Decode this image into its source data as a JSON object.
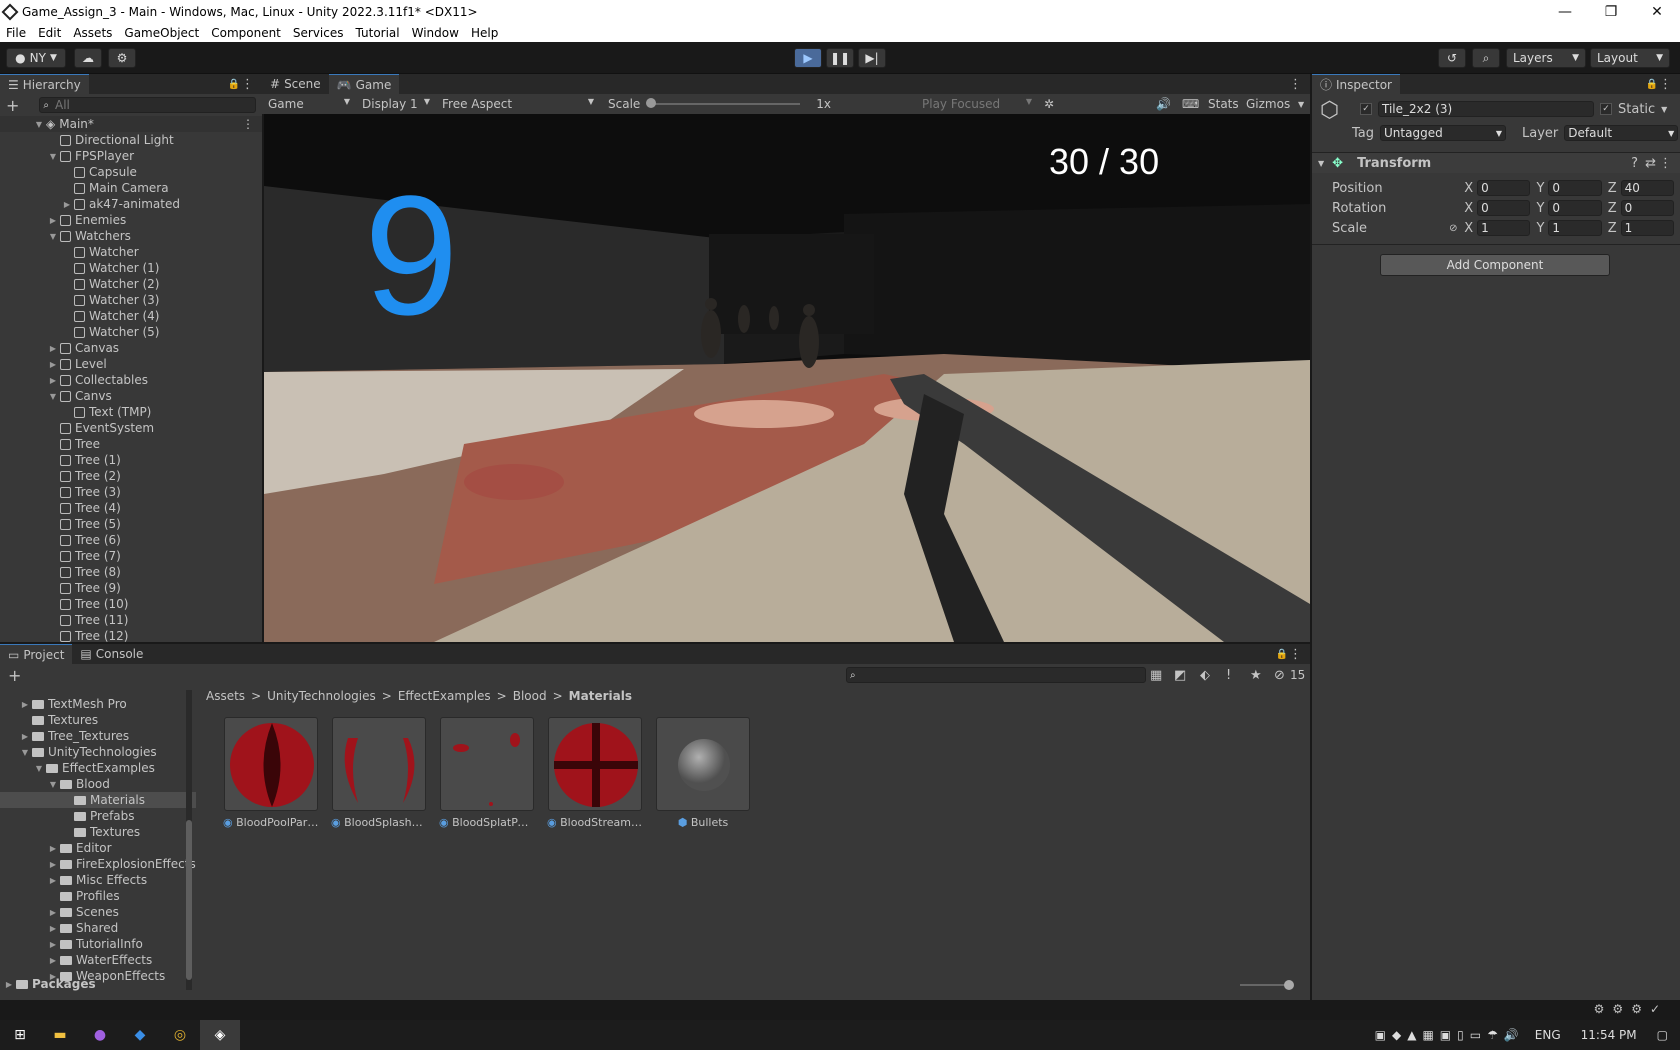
{
  "window": {
    "title": "Game_Assign_3 - Main - Windows, Mac, Linux - Unity 2022.3.11f1* <DX11>",
    "minimize": "—",
    "maximize": "❐",
    "close": "✕"
  },
  "menu": [
    "File",
    "Edit",
    "Assets",
    "GameObject",
    "Component",
    "Services",
    "Tutorial",
    "Window",
    "Help"
  ],
  "toolbar": {
    "account": "NY",
    "layers": "Layers",
    "layout": "Layout"
  },
  "hierarchy": {
    "tab": "Hierarchy",
    "search_placeholder": "All",
    "scene": "Main*",
    "items": [
      {
        "label": "Directional Light",
        "depth": 1,
        "arrow": ""
      },
      {
        "label": "FPSPlayer",
        "depth": 1,
        "arrow": "▼"
      },
      {
        "label": "Capsule",
        "depth": 2,
        "arrow": ""
      },
      {
        "label": "Main Camera",
        "depth": 2,
        "arrow": ""
      },
      {
        "label": "ak47-animated",
        "depth": 2,
        "arrow": "▶"
      },
      {
        "label": "Enemies",
        "depth": 1,
        "arrow": "▶"
      },
      {
        "label": "Watchers",
        "depth": 1,
        "arrow": "▼"
      },
      {
        "label": "Watcher",
        "depth": 2,
        "arrow": ""
      },
      {
        "label": "Watcher (1)",
        "depth": 2,
        "arrow": ""
      },
      {
        "label": "Watcher (2)",
        "depth": 2,
        "arrow": ""
      },
      {
        "label": "Watcher (3)",
        "depth": 2,
        "arrow": ""
      },
      {
        "label": "Watcher (4)",
        "depth": 2,
        "arrow": ""
      },
      {
        "label": "Watcher (5)",
        "depth": 2,
        "arrow": ""
      },
      {
        "label": "Canvas",
        "depth": 1,
        "arrow": "▶"
      },
      {
        "label": "Level",
        "depth": 1,
        "arrow": "▶"
      },
      {
        "label": "Collectables",
        "depth": 1,
        "arrow": "▶"
      },
      {
        "label": "Canvs",
        "depth": 1,
        "arrow": "▼"
      },
      {
        "label": "Text (TMP)",
        "depth": 2,
        "arrow": ""
      },
      {
        "label": "EventSystem",
        "depth": 1,
        "arrow": ""
      },
      {
        "label": "Tree",
        "depth": 1,
        "arrow": ""
      },
      {
        "label": "Tree (1)",
        "depth": 1,
        "arrow": ""
      },
      {
        "label": "Tree (2)",
        "depth": 1,
        "arrow": ""
      },
      {
        "label": "Tree (3)",
        "depth": 1,
        "arrow": ""
      },
      {
        "label": "Tree (4)",
        "depth": 1,
        "arrow": ""
      },
      {
        "label": "Tree (5)",
        "depth": 1,
        "arrow": ""
      },
      {
        "label": "Tree (6)",
        "depth": 1,
        "arrow": ""
      },
      {
        "label": "Tree (7)",
        "depth": 1,
        "arrow": ""
      },
      {
        "label": "Tree (8)",
        "depth": 1,
        "arrow": ""
      },
      {
        "label": "Tree (9)",
        "depth": 1,
        "arrow": ""
      },
      {
        "label": "Tree (10)",
        "depth": 1,
        "arrow": ""
      },
      {
        "label": "Tree (11)",
        "depth": 1,
        "arrow": ""
      },
      {
        "label": "Tree (12)",
        "depth": 1,
        "arrow": ""
      }
    ]
  },
  "game_view": {
    "tabs": [
      "Scene",
      "Game"
    ],
    "mode": "Game",
    "display": "Display 1",
    "aspect": "Free Aspect",
    "scale_label": "Scale",
    "scale_value": "1x",
    "play_focused": "Play Focused",
    "stats": "Stats",
    "gizmos": "Gizmos",
    "hud_count": "9",
    "hud_ammo": "30 / 30",
    "hud_color": "#1f8ef0"
  },
  "inspector": {
    "tab": "Inspector",
    "object_name": "Tile_2x2 (3)",
    "static_label": "Static",
    "tag_label": "Tag",
    "tag_value": "Untagged",
    "layer_label": "Layer",
    "layer_value": "Default",
    "component": "Transform",
    "position_label": "Position",
    "rotation_label": "Rotation",
    "scale_label": "Scale",
    "position": {
      "x": "0",
      "y": "0",
      "z": "40"
    },
    "rotation": {
      "x": "0",
      "y": "0",
      "z": "0"
    },
    "scale": {
      "x": "1",
      "y": "1",
      "z": "1"
    },
    "axis": {
      "x": "X",
      "y": "Y",
      "z": "Z"
    },
    "add_component": "Add Component"
  },
  "project": {
    "tabs": [
      "Project",
      "Console"
    ],
    "hidden_count": "15",
    "breadcrumb": [
      "Assets",
      "UnityTechnologies",
      "EffectExamples",
      "Blood",
      "Materials"
    ],
    "tree": [
      {
        "label": "TextMesh Pro",
        "depth": 1,
        "arrow": "▶"
      },
      {
        "label": "Textures",
        "depth": 1,
        "arrow": ""
      },
      {
        "label": "Tree_Textures",
        "depth": 1,
        "arrow": "▶"
      },
      {
        "label": "UnityTechnologies",
        "depth": 1,
        "arrow": "▼"
      },
      {
        "label": "EffectExamples",
        "depth": 2,
        "arrow": "▼"
      },
      {
        "label": "Blood",
        "depth": 3,
        "arrow": "▼"
      },
      {
        "label": "Materials",
        "depth": 4,
        "arrow": "",
        "selected": true
      },
      {
        "label": "Prefabs",
        "depth": 4,
        "arrow": ""
      },
      {
        "label": "Textures",
        "depth": 4,
        "arrow": ""
      },
      {
        "label": "Editor",
        "depth": 3,
        "arrow": "▶"
      },
      {
        "label": "FireExplosionEffects",
        "depth": 3,
        "arrow": "▶"
      },
      {
        "label": "Misc Effects",
        "depth": 3,
        "arrow": "▶"
      },
      {
        "label": "Profiles",
        "depth": 3,
        "arrow": ""
      },
      {
        "label": "Scenes",
        "depth": 3,
        "arrow": "▶"
      },
      {
        "label": "Shared",
        "depth": 3,
        "arrow": "▶"
      },
      {
        "label": "TutorialInfo",
        "depth": 3,
        "arrow": "▶"
      },
      {
        "label": "WaterEffects",
        "depth": 3,
        "arrow": "▶"
      },
      {
        "label": "WeaponEffects",
        "depth": 3,
        "arrow": "▶"
      }
    ],
    "packages": "Packages",
    "assets": [
      "BloodPoolParticle",
      "BloodSplashPartic...",
      "BloodSplatParticle",
      "BloodStreamParti...",
      "Bullets"
    ]
  },
  "taskbar": {
    "lang": "ENG",
    "time": "11:54 PM"
  }
}
